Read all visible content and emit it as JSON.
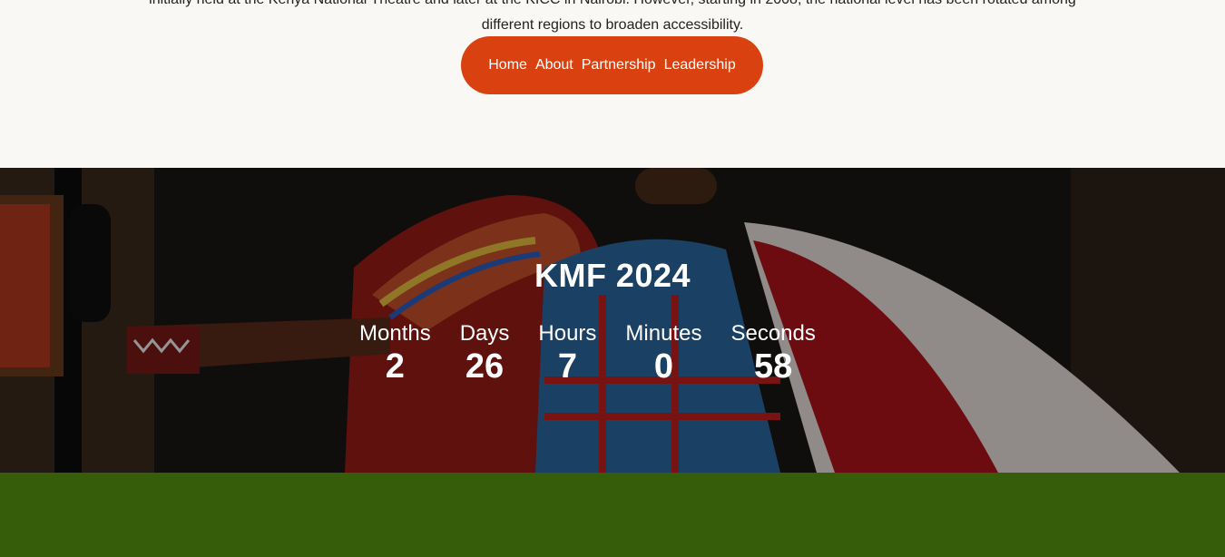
{
  "intro": {
    "line1": "initially held at the Kenya National Theatre and later at the KICC in Nairobi. However, starting in 2008, the national level has been rotated among",
    "line2": "different regions to broaden accessibility."
  },
  "nav": {
    "items": [
      {
        "label": "Home"
      },
      {
        "label": "About"
      },
      {
        "label": "Partnership"
      },
      {
        "label": "Leadership"
      }
    ],
    "color": "#d94210"
  },
  "countdown": {
    "title": "KMF 2024",
    "units": [
      {
        "label": "Months",
        "value": "2"
      },
      {
        "label": "Days",
        "value": "26"
      },
      {
        "label": "Hours",
        "value": "7"
      },
      {
        "label": "Minutes",
        "value": "0"
      },
      {
        "label": "Seconds",
        "value": "58"
      }
    ]
  },
  "colors": {
    "page_bg": "#faf8f4",
    "accent": "#d94210",
    "footer_band": "#365e0a"
  }
}
